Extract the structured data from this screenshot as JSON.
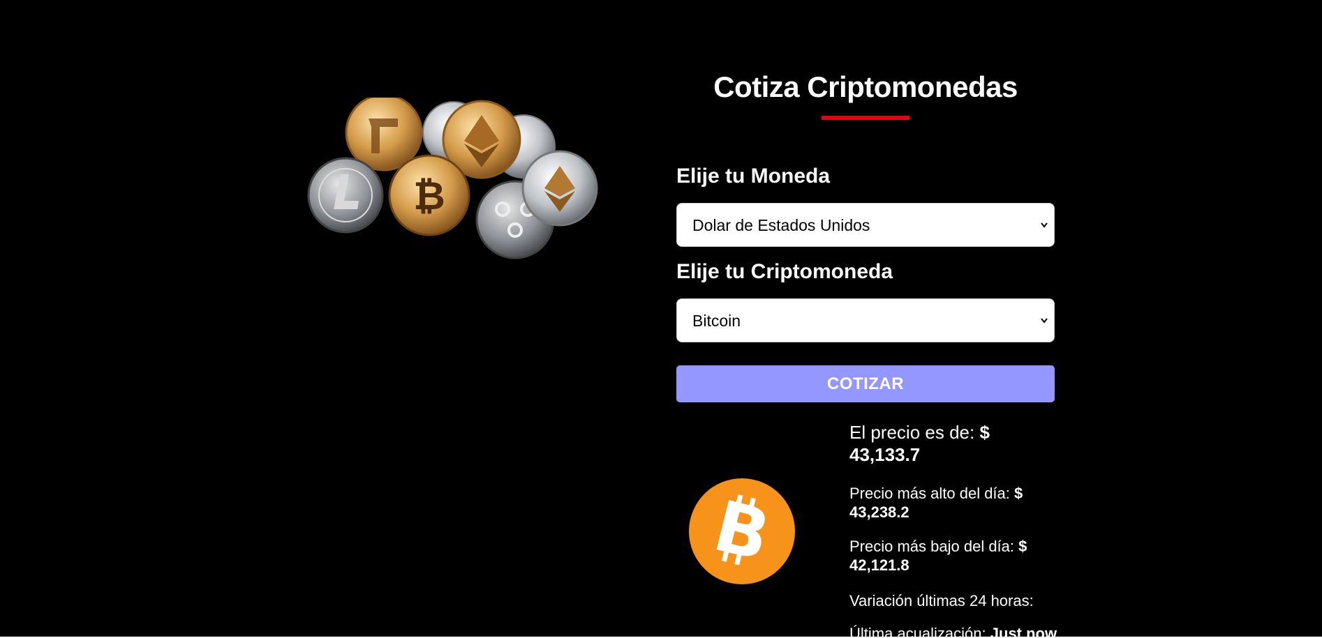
{
  "header": {
    "title": "Cotiza Criptomonedas"
  },
  "form": {
    "currency_label": "Elije tu Moneda",
    "currency_selected": "Dolar de Estados Unidos",
    "crypto_label": "Elije tu Criptomoneda",
    "crypto_selected": "Bitcoin",
    "submit_label": "COTIZAR"
  },
  "result": {
    "price_label": "El precio es de:",
    "price_currency": "$",
    "price_value": "43,133.7",
    "high_label": "Precio más alto del día:",
    "high_currency": "$",
    "high_value": "43,238.2",
    "low_label": "Precio más bajo del día:",
    "low_currency": "$",
    "low_value": "42,121.8",
    "change_label": "Variación últimas 24 horas:",
    "change_value": "",
    "updated_label": "Última acualización:",
    "updated_value": "Just now"
  },
  "icons": {
    "crypto_logo": "bitcoin-icon",
    "hero_image": "crypto-coins-image",
    "select_arrow": "chevron-down-icon"
  },
  "colors": {
    "background": "#000000",
    "accent": "#e3000f",
    "button": "#9497ff",
    "bitcoin": "#f7931a"
  }
}
